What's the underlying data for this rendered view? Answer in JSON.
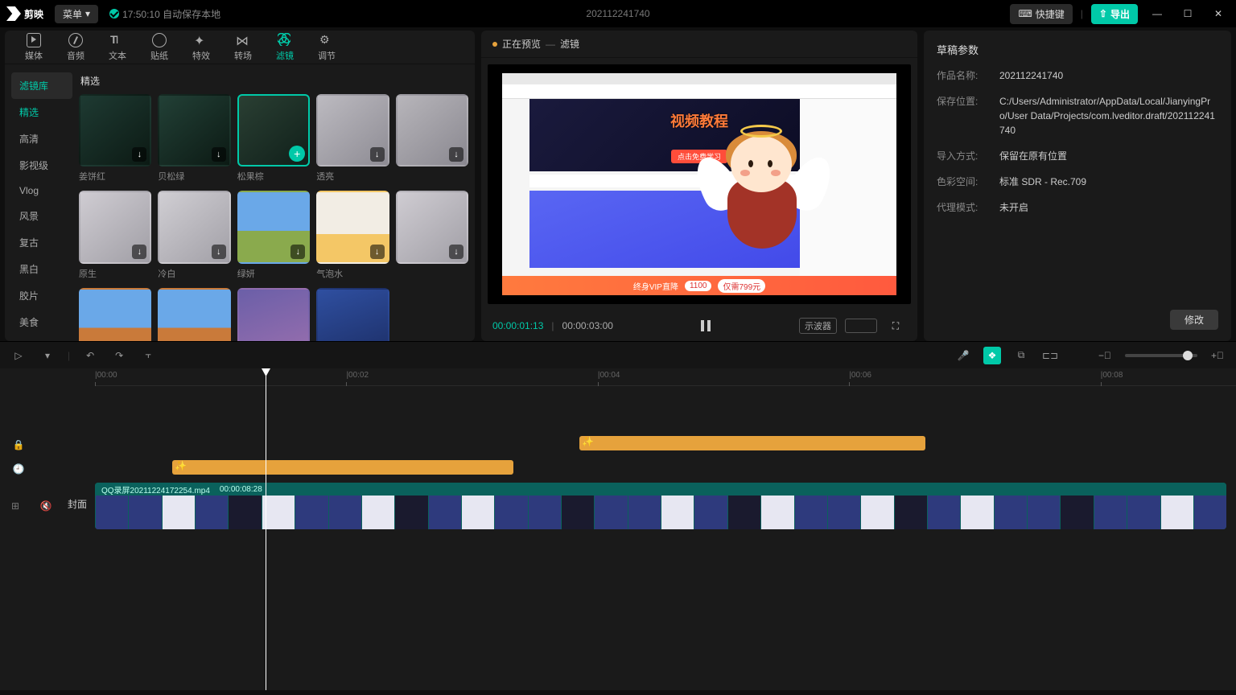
{
  "titlebar": {
    "app_name": "剪映",
    "menu": "菜单",
    "autosave": "17:50:10 自动保存本地",
    "project": "202112241740",
    "shortcut": "快捷键",
    "export": "导出"
  },
  "tabs": [
    {
      "id": "media",
      "label": "媒体"
    },
    {
      "id": "audio",
      "label": "音频"
    },
    {
      "id": "text",
      "label": "文本"
    },
    {
      "id": "sticker",
      "label": "贴纸"
    },
    {
      "id": "effect",
      "label": "特效"
    },
    {
      "id": "transition",
      "label": "转场"
    },
    {
      "id": "filter",
      "label": "滤镜",
      "active": true
    },
    {
      "id": "adjust",
      "label": "调节"
    }
  ],
  "filter_lib": {
    "library": "滤镜库",
    "categories": [
      "精选",
      "高清",
      "影视级",
      "Vlog",
      "风景",
      "复古",
      "黑白",
      "胶片",
      "美食"
    ],
    "selected_cat": "精选",
    "heading": "精选",
    "items": [
      {
        "name": "姜饼红",
        "bg": "linear-gradient(140deg,#1e3a32,#0c1a14)",
        "dl": true
      },
      {
        "name": "贝松绿",
        "bg": "linear-gradient(140deg,#224036,#0c1a14)",
        "dl": true
      },
      {
        "name": "松果棕",
        "bg": "linear-gradient(140deg,#2a3f33,#10201a)",
        "sel": true,
        "add": true
      },
      {
        "name": "透亮",
        "bg": "linear-gradient(140deg,#bcbac0,#8e8c94)",
        "dl": true
      },
      {
        "name": "",
        "bg": "linear-gradient(140deg,#b7b5ba,#8a8890)",
        "dl": true
      },
      {
        "name": "原生",
        "bg": "linear-gradient(140deg,#cfccd2,#a19fa6)",
        "dl": true
      },
      {
        "name": "冷白",
        "bg": "linear-gradient(140deg,#d0ced3,#a2a0a7)",
        "dl": true
      },
      {
        "name": "绿妍",
        "bg": "linear-gradient(180deg,#6aa8e8 55%,#8aaa4d 55%)",
        "dl": true
      },
      {
        "name": "气泡水",
        "bg": "linear-gradient(180deg,#f2ede4 60%,#f4c766 60%)",
        "dl": true
      },
      {
        "name": "",
        "bg": "linear-gradient(140deg,#cfccd2,#a19fa6)",
        "dl": true
      },
      {
        "name": "",
        "bg": "linear-gradient(180deg,#6aa8e8 55%,#c97a3a 55%)",
        "dl": true
      },
      {
        "name": "",
        "bg": "linear-gradient(180deg,#6aa8e8 55%,#c97a3a 55%)",
        "dl": true
      },
      {
        "name": "",
        "bg": "linear-gradient(160deg,#6b5fa8,#9a6fae)",
        "dl": true
      },
      {
        "name": "",
        "bg": "linear-gradient(160deg,#2f4fa0,#1c2e66)",
        "dl": true
      }
    ]
  },
  "preview": {
    "label_a": "正在预览",
    "dash": "—",
    "label_b": "滤镜",
    "hero_text": "视频教程",
    "hero_btn": "点击免费学习",
    "ad_left": "终身VIP直降",
    "ad_price": "1100",
    "ad_right": "仅需799元",
    "cur": "00:00:01:13",
    "dur": "00:00:03:00",
    "scope": "示波器"
  },
  "props": {
    "title": "草稿参数",
    "rows": [
      {
        "k": "作品名称:",
        "v": "202112241740"
      },
      {
        "k": "保存位置:",
        "v": "C:/Users/Administrator/AppData/Local/JianyingPro/User Data/Projects/com.lveditor.draft/202112241740"
      },
      {
        "k": "导入方式:",
        "v": "保留在原有位置"
      },
      {
        "k": "色彩空间:",
        "v": "标准 SDR - Rec.709"
      },
      {
        "k": "代理模式:",
        "v": "未开启"
      }
    ],
    "modify": "修改"
  },
  "ruler": [
    "00:00",
    "00:02",
    "00:04",
    "00:06",
    "00:08"
  ],
  "clip": {
    "name": "QQ录屏20211224172254.mp4",
    "dur": "00:00:08:28"
  },
  "cover": "封面"
}
